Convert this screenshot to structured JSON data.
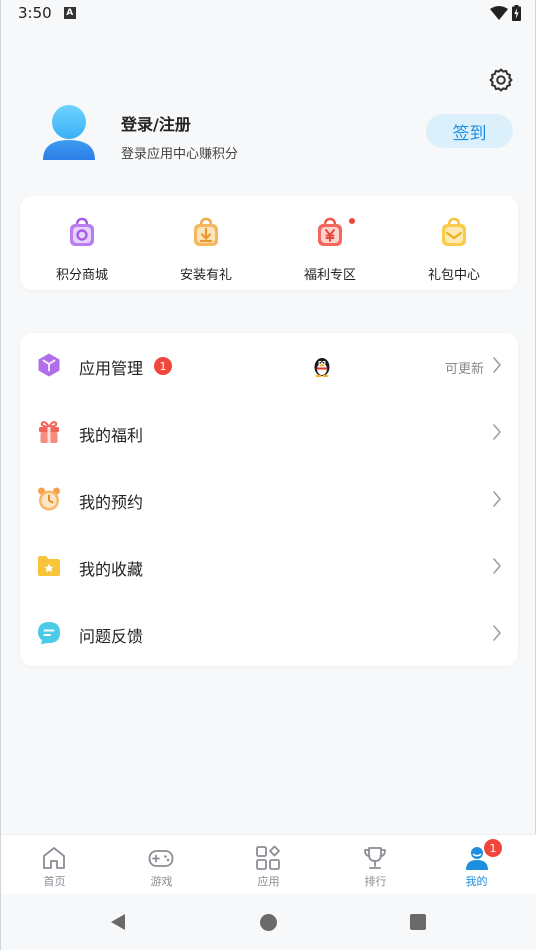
{
  "status_bar": {
    "time": "3:50",
    "notification_letter": "A"
  },
  "profile": {
    "login_title": "登录/注册",
    "login_subtitle": "登录应用中心赚积分",
    "checkin_label": "签到"
  },
  "quick_actions": [
    {
      "label": "积分商城",
      "icon": "points-mall-icon",
      "color": "#a85be8"
    },
    {
      "label": "安装有礼",
      "icon": "install-gift-icon",
      "color": "#f2a94a"
    },
    {
      "label": "福利专区",
      "icon": "welfare-zone-icon",
      "color": "#f0564a",
      "has_dot": true
    },
    {
      "label": "礼包中心",
      "icon": "gift-pack-icon",
      "color": "#f7c23c"
    }
  ],
  "menu": [
    {
      "label": "应用管理",
      "icon": "app-manage-icon",
      "badge": "1",
      "status": "可更新",
      "has_qq": true
    },
    {
      "label": "我的福利",
      "icon": "gift-box-icon"
    },
    {
      "label": "我的预约",
      "icon": "alarm-clock-icon"
    },
    {
      "label": "我的收藏",
      "icon": "star-folder-icon"
    },
    {
      "label": "问题反馈",
      "icon": "feedback-bubble-icon"
    }
  ],
  "tabs": [
    {
      "label": "首页",
      "icon": "home-icon"
    },
    {
      "label": "游戏",
      "icon": "gamepad-icon"
    },
    {
      "label": "应用",
      "icon": "apps-grid-icon"
    },
    {
      "label": "排行",
      "icon": "trophy-icon"
    },
    {
      "label": "我的",
      "icon": "user-icon",
      "active": true,
      "badge": "1"
    }
  ],
  "colors": {
    "accent": "#1d8fe0",
    "badge": "#f0463c",
    "checkin_bg": "#dcf0fb",
    "page_bg": "#f6f8fa"
  }
}
